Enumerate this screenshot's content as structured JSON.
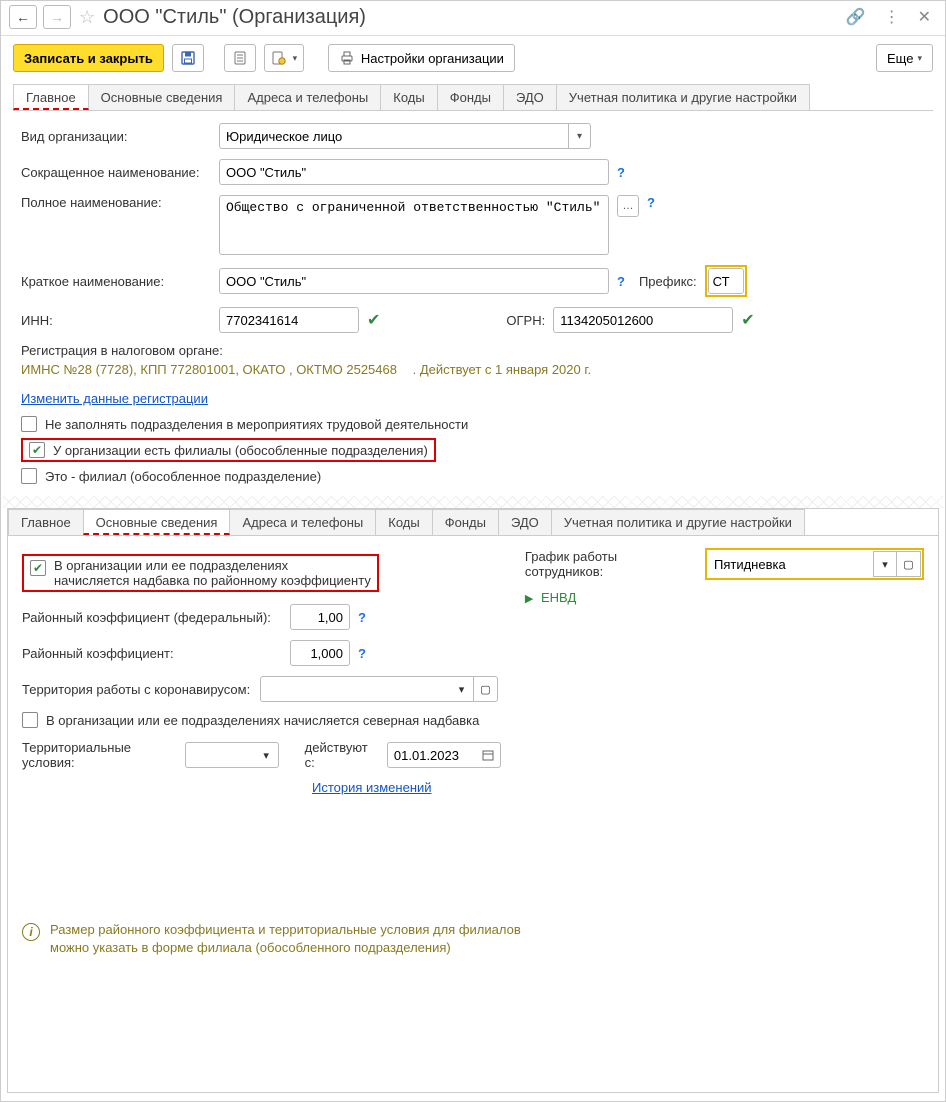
{
  "header": {
    "title": "ООО \"Стиль\" (Организация)"
  },
  "toolbar": {
    "save_close": "Записать и закрыть",
    "settings": "Настройки организации",
    "more": "Еще"
  },
  "tabs1": [
    "Главное",
    "Основные сведения",
    "Адреса и телефоны",
    "Коды",
    "Фонды",
    "ЭДО",
    "Учетная политика и другие настройки"
  ],
  "main": {
    "org_kind_label": "Вид организации:",
    "org_kind_value": "Юридическое лицо",
    "short_name_label": "Сокращенное наименование:",
    "short_name_value": "ООО \"Стиль\"",
    "full_name_label": "Полное наименование:",
    "full_name_value": "Общество с ограниченной ответственностью \"Стиль\"",
    "brief_name_label": "Краткое наименование:",
    "brief_name_value": "ООО \"Стиль\"",
    "prefix_label": "Префикс:",
    "prefix_value": "СТ",
    "inn_label": "ИНН:",
    "inn_value": "7702341614",
    "ogrn_label": "ОГРН:",
    "ogrn_value": "1134205012600",
    "tax_reg_label": "Регистрация в налоговом органе:",
    "tax_reg_line": "ИМНС №28 (7728), КПП 772801001, ОКАТО , ОКТМО 2525468",
    "tax_reg_date": ". Действует с 1 января 2020 г.",
    "change_reg_link": "Изменить данные регистрации",
    "chk_dont_fill": "Не заполнять подразделения в мероприятиях трудовой деятельности",
    "chk_has_branches": "У организации есть филиалы (обособленные подразделения)",
    "chk_is_branch": "Это - филиал (обособленное подразделение)"
  },
  "tabs2": [
    "Главное",
    "Основные сведения",
    "Адреса и телефоны",
    "Коды",
    "Фонды",
    "ЭДО",
    "Учетная политика и другие настройки"
  ],
  "details": {
    "chk_rk_label1": "В организации или ее подразделениях",
    "chk_rk_label2": "начисляется надбавка по районному коэффициенту",
    "rk_fed_label": "Районный коэффициент (федеральный):",
    "rk_fed_value": "1,00",
    "rk_label": "Районный коэффициент:",
    "rk_value": "1,000",
    "covid_label": "Территория работы с коронавирусом:",
    "chk_north": "В организации или ее подразделениях начисляется северная надбавка",
    "terr_label": "Территориальные условия:",
    "effective_label": "действуют с:",
    "effective_value": "01.01.2023",
    "history_link": "История изменений",
    "schedule_label": "График работы сотрудников:",
    "schedule_value": "Пятидневка",
    "envd": "ЕНВД",
    "info": "Размер районного коэффициента и территориальные условия для филиалов можно указать в форме филиала (обособленного подразделения)"
  }
}
